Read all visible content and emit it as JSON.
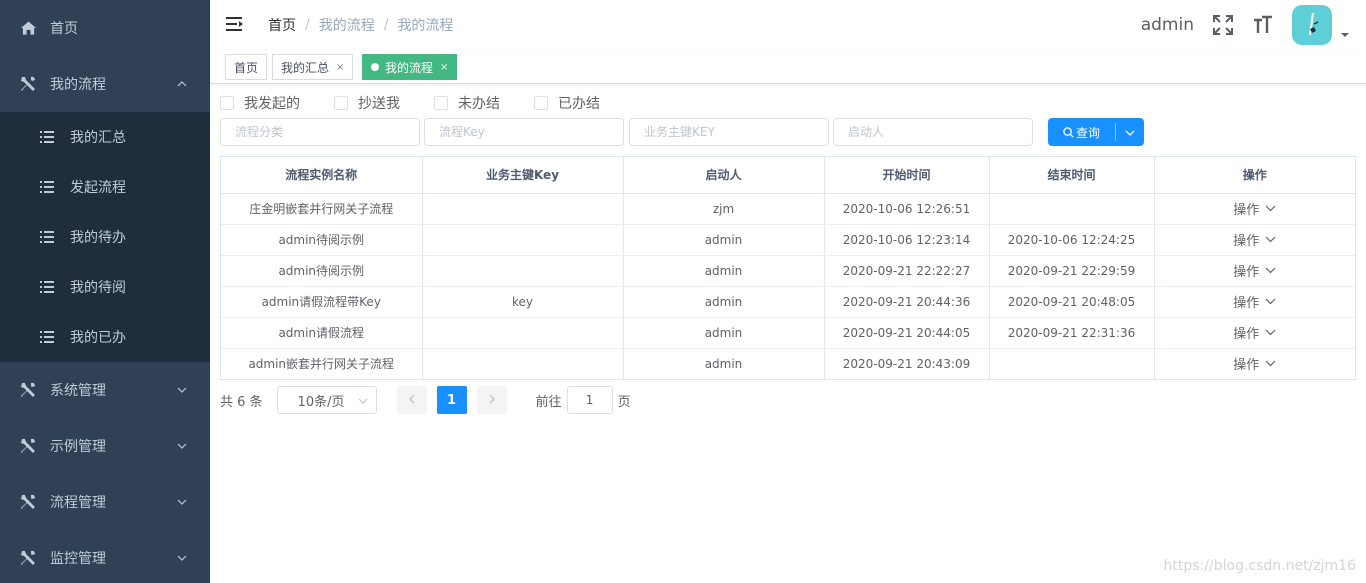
{
  "sidebar": {
    "home": "首页",
    "my_process": {
      "label": "我的流程",
      "items": [
        {
          "label": "我的汇总"
        },
        {
          "label": "发起流程"
        },
        {
          "label": "我的待办"
        },
        {
          "label": "我的待阅"
        },
        {
          "label": "我的已办"
        }
      ]
    },
    "groups": [
      {
        "label": "系统管理"
      },
      {
        "label": "示例管理"
      },
      {
        "label": "流程管理"
      },
      {
        "label": "监控管理"
      }
    ]
  },
  "navbar": {
    "breadcrumb": [
      "首页",
      "我的流程",
      "我的流程"
    ],
    "separator": "/",
    "username": "admin"
  },
  "tags": [
    {
      "label": "首页",
      "closable": false,
      "active": false
    },
    {
      "label": "我的汇总",
      "closable": true,
      "active": false
    },
    {
      "label": "我的流程",
      "closable": true,
      "active": true
    }
  ],
  "tag_close": "×",
  "filters": {
    "checkboxes": [
      {
        "label": "我发起的",
        "checked": false
      },
      {
        "label": "抄送我",
        "checked": false
      },
      {
        "label": "未办结",
        "checked": false
      },
      {
        "label": "已办结",
        "checked": false
      }
    ],
    "category_placeholder": "流程分类",
    "key_placeholder": "流程Key",
    "bizkey_placeholder": "业务主键KEY",
    "starter_placeholder": "启动人",
    "query_label": "查询"
  },
  "table": {
    "columns": [
      "流程实例名称",
      "业务主键Key",
      "启动人",
      "开始时间",
      "结束时间",
      "操作"
    ],
    "op_label": "操作",
    "rows": [
      {
        "name": "庄金明嵌套并行网关子流程",
        "key": "",
        "starter": "zjm",
        "start": "2020-10-06 12:26:51",
        "end": ""
      },
      {
        "name": "admin待阅示例",
        "key": "",
        "starter": "admin",
        "start": "2020-10-06 12:23:14",
        "end": "2020-10-06 12:24:25"
      },
      {
        "name": "admin待阅示例",
        "key": "",
        "starter": "admin",
        "start": "2020-09-21 22:22:27",
        "end": "2020-09-21 22:29:59"
      },
      {
        "name": "admin请假流程带Key",
        "key": "key",
        "starter": "admin",
        "start": "2020-09-21 20:44:36",
        "end": "2020-09-21 20:48:05"
      },
      {
        "name": "admin请假流程",
        "key": "",
        "starter": "admin",
        "start": "2020-09-21 20:44:05",
        "end": "2020-09-21 22:31:36"
      },
      {
        "name": "admin嵌套并行网关子流程",
        "key": "",
        "starter": "admin",
        "start": "2020-09-21 20:43:09",
        "end": ""
      }
    ]
  },
  "pagination": {
    "total": "共 6 条",
    "page_size": "10条/页",
    "current_page": "1",
    "goto_prefix": "前往",
    "goto_value": "1",
    "goto_suffix": "页"
  },
  "watermark": "https://blog.csdn.net/zjm16",
  "colors": {
    "sidebar_bg": "#304156",
    "submenu_bg": "#1f2d3d",
    "primary": "#1890ff",
    "active_tag": "#42b983",
    "avatar": "#5ecfd6"
  },
  "icons": {
    "home": "home-icon",
    "tools": "tools-icon",
    "list": "list-icon",
    "hamburger": "hamburger-icon",
    "fullscreen": "fullscreen-icon",
    "font_size": "font-size-icon",
    "search": "search-icon"
  }
}
